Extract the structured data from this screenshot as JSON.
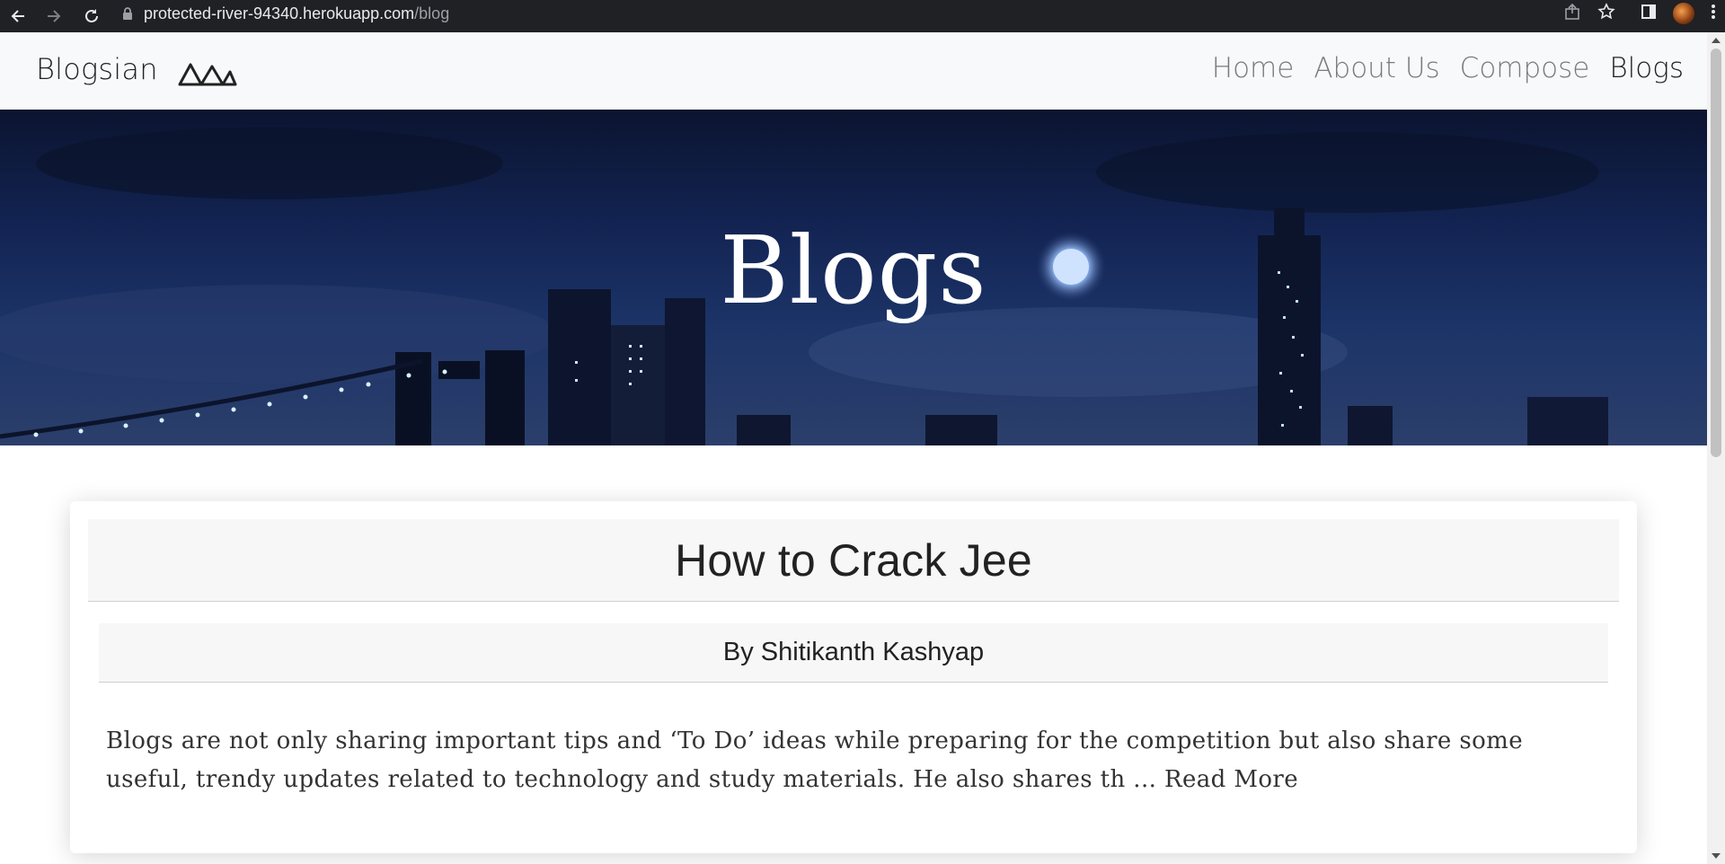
{
  "browser": {
    "url_host": "protected-river-94340.herokuapp.com",
    "url_path": "/blog"
  },
  "navbar": {
    "brand": "Blogsian",
    "links": [
      {
        "label": "Home",
        "active": false
      },
      {
        "label": "About Us",
        "active": false
      },
      {
        "label": "Compose",
        "active": false
      },
      {
        "label": "Blogs",
        "active": true
      }
    ]
  },
  "hero": {
    "title": "Blogs"
  },
  "posts": [
    {
      "title": "How to Crack Jee",
      "author": "By Shitikanth Kashyap",
      "excerpt": "Blogs are not only sharing important tips and ‘To Do’ ideas while preparing for the competition but also share some useful, trendy updates related to technology and study materials. He also shares th ... ",
      "read_more": "Read More"
    }
  ],
  "colors": {
    "browser_bar": "#202124",
    "navbar_bg": "#f8f9fa",
    "hero_sky": "#132453",
    "card_header_bg": "#f7f7f7"
  }
}
